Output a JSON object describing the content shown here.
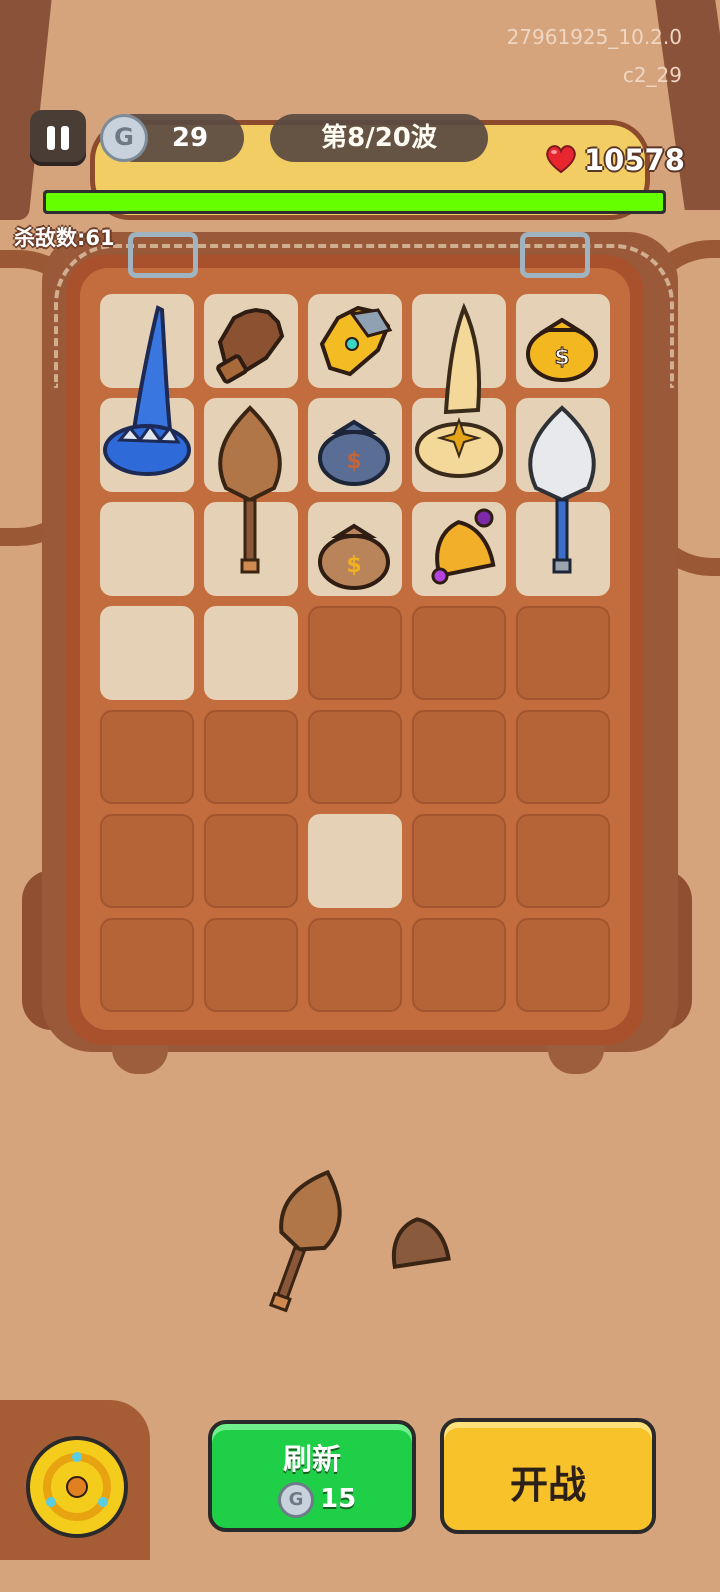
{
  "version": {
    "build": "27961925_10.2.0",
    "level": "c2_29"
  },
  "hud": {
    "coins": "29",
    "wave": "第8/20波",
    "hp": "10578",
    "wave_progress": 1.0,
    "kills_label": "杀敌数:61"
  },
  "grid": {
    "rows": 7,
    "cols": 5,
    "cells": [
      [
        "open",
        "open",
        "open",
        "open",
        "open"
      ],
      [
        "open",
        "open",
        "open",
        "open",
        "open"
      ],
      [
        "open",
        "open",
        "open",
        "open",
        "open"
      ],
      [
        "open",
        "open",
        "locked",
        "locked",
        "locked"
      ],
      [
        "locked",
        "locked",
        "locked",
        "locked",
        "locked"
      ],
      [
        "locked",
        "locked",
        "open",
        "locked",
        "locked"
      ],
      [
        "locked",
        "locked",
        "locked",
        "locked",
        "locked"
      ]
    ],
    "items": [
      {
        "name": "blue-wizard-hat-icon"
      },
      {
        "name": "leather-glove-icon"
      },
      {
        "name": "golden-gauntlet-icon"
      },
      {
        "name": "golden-wizard-hat-icon"
      },
      {
        "name": "golden-money-bag-icon"
      },
      {
        "name": "wooden-leaf-mace-icon"
      },
      {
        "name": "blue-money-bag-icon"
      },
      {
        "name": "brown-money-bag-icon"
      },
      {
        "name": "golden-bell-icon"
      },
      {
        "name": "silver-leaf-mace-icon"
      }
    ]
  },
  "shop": {
    "items": [
      {
        "name": "wooden-leaf-mace-icon"
      },
      {
        "name": "bronze-bell-icon"
      }
    ]
  },
  "buttons": {
    "refresh_label": "刷新",
    "refresh_cost": "15",
    "fight_label": "开战"
  },
  "colors": {
    "progress": "#66ff00",
    "refresh": "#1fcf47",
    "fight": "#f8c22a"
  }
}
